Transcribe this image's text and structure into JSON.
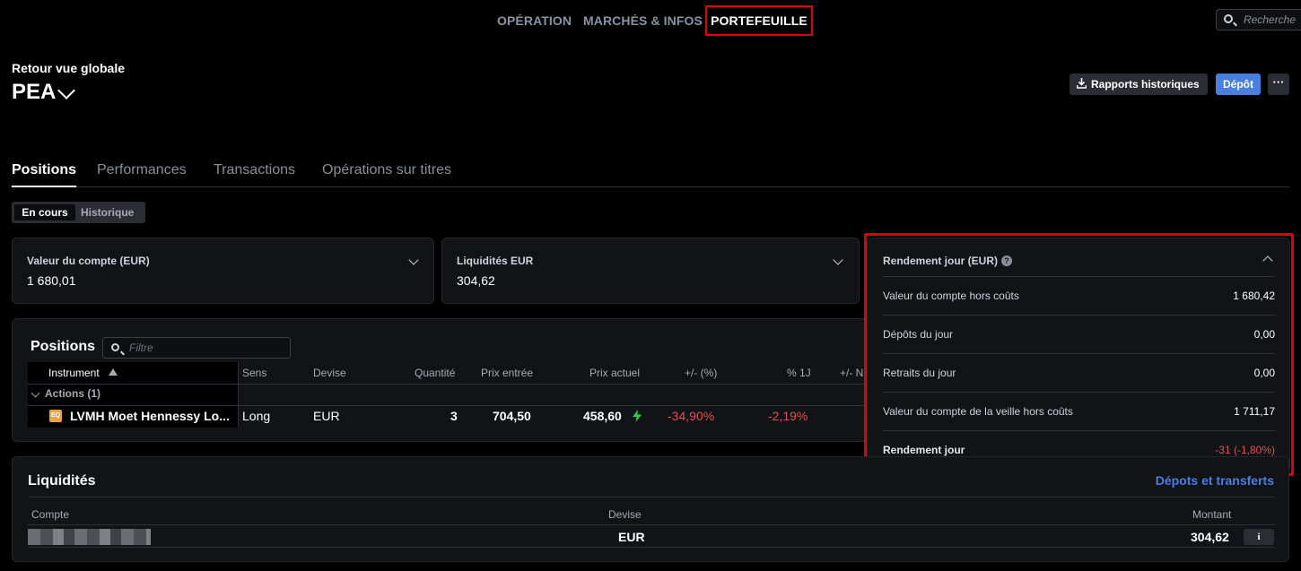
{
  "nav": {
    "items": [
      "OPÉRATION",
      "MARCHÉS & INFOS",
      "PORTEFEUILLE"
    ],
    "active": "PORTEFEUILLE",
    "search_placeholder": "Recherche"
  },
  "header": {
    "back_label": "Retour vue globale",
    "account_name": "PEA",
    "reports_button": "Rapports historiques",
    "deposit_button": "Dépôt",
    "more_button": "···"
  },
  "tabs": [
    "Positions",
    "Performances",
    "Transactions",
    "Opérations sur titres"
  ],
  "segmented": {
    "active": "En cours",
    "inactive": "Historique"
  },
  "cards": {
    "account_value": {
      "label": "Valeur du compte (EUR)",
      "value": "1 680,01"
    },
    "cash": {
      "label": "Liquidités EUR",
      "value": "304,62"
    }
  },
  "positions": {
    "title": "Positions",
    "filter_placeholder": "Filtre",
    "columns": [
      "Instrument",
      "Sens",
      "Devise",
      "Quantité",
      "Prix entrée",
      "Prix actuel",
      "+/- (%)",
      "% 1J",
      "+/- N"
    ],
    "group_label": "Actions (1)",
    "rows": [
      {
        "badge": "EQ",
        "instrument": "LVMH Moet Hennessy Lo...",
        "sens": "Long",
        "devise": "EUR",
        "quantite": "3",
        "prix_entree": "704,50",
        "prix_actuel": "458,60",
        "pct_change": "-34,90%",
        "pct_1j": "-2,19%"
      }
    ]
  },
  "rendement": {
    "title": "Rendement jour (EUR)",
    "help_icon": "?",
    "rows": [
      {
        "label": "Valeur du compte hors coûts",
        "value": "1 680,42"
      },
      {
        "label": "Dépôts du jour",
        "value": "0,00"
      },
      {
        "label": "Retraits du jour",
        "value": "0,00"
      },
      {
        "label": "Valeur du compte de la veille hors coûts",
        "value": "1 711,17"
      },
      {
        "label": "Rendement jour",
        "value": "-31 (-1,80%)"
      }
    ]
  },
  "liquidites": {
    "title": "Liquidités",
    "link": "Dépots et transferts",
    "columns": [
      "Compte",
      "Devise",
      "Montant"
    ],
    "row": {
      "devise": "EUR",
      "montant": "304,62",
      "info": "i"
    }
  },
  "colors": {
    "accent": "#4a7fe0",
    "negative": "#e05252",
    "positive": "#2ecc40",
    "highlight": "#e00000"
  }
}
